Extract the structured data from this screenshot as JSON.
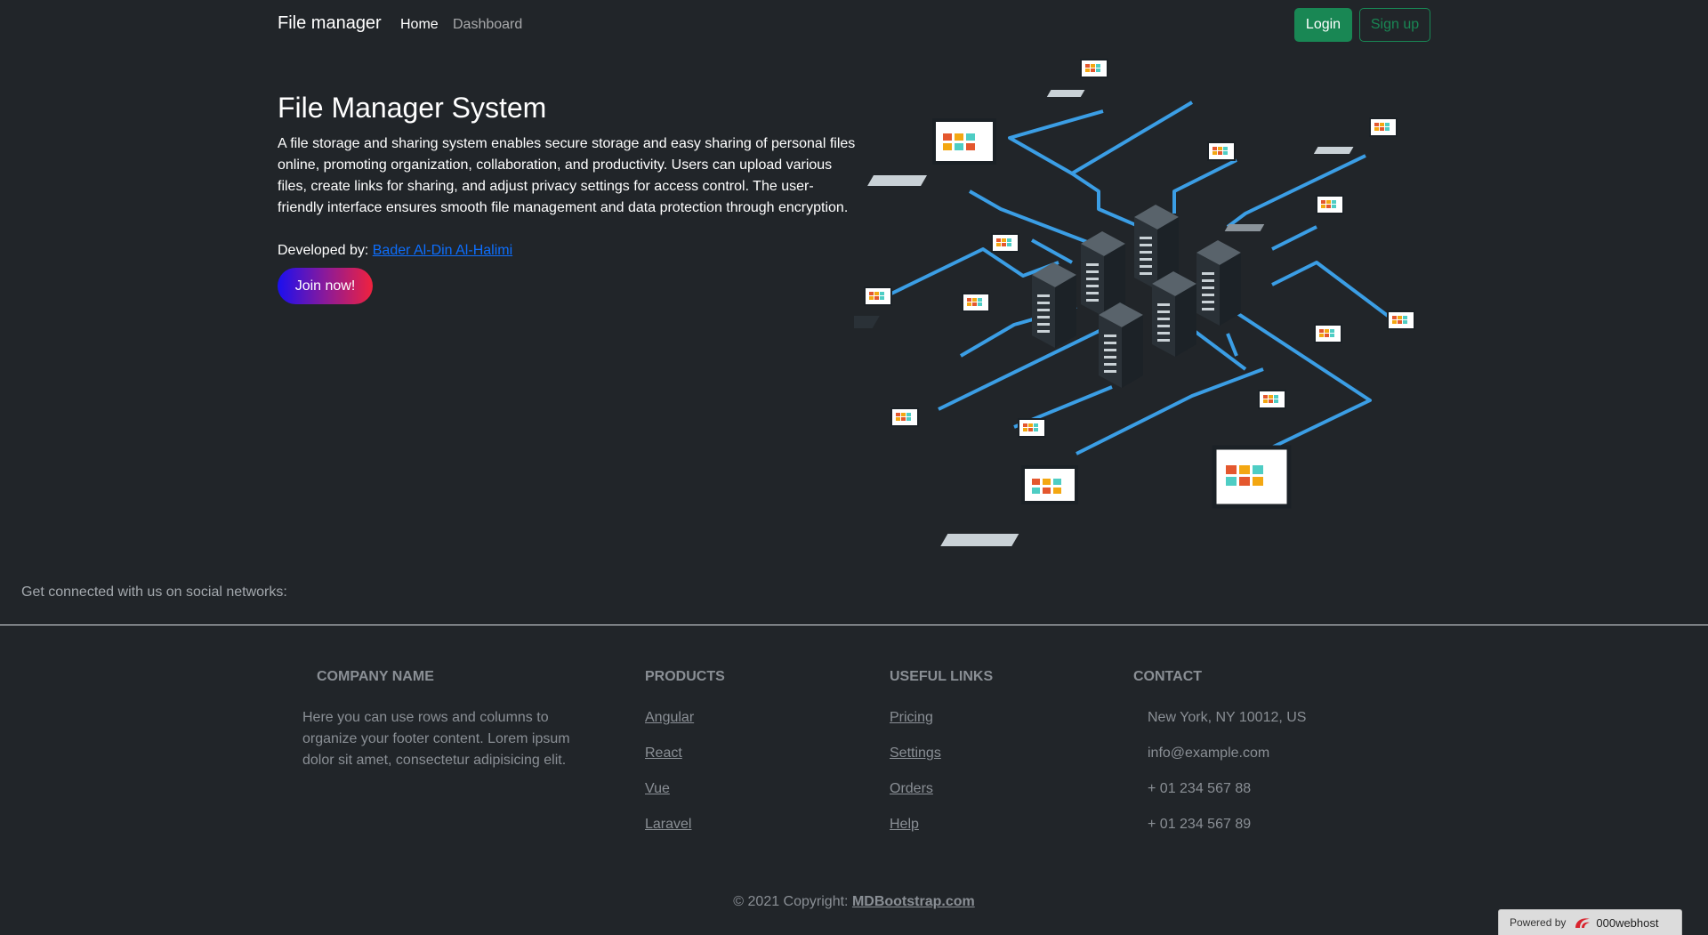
{
  "navbar": {
    "brand": "File manager",
    "links": [
      "Home",
      "Dashboard"
    ],
    "login_label": "Login",
    "signup_label": "Sign up"
  },
  "hero": {
    "title": "File Manager System",
    "description": "A file storage and sharing system enables secure storage and easy sharing of personal files online, promoting organization, collaboration, and productivity. Users can upload various files, create links for sharing, and adjust privacy settings for access control. The user-friendly interface ensures smooth file management and data protection through encryption.",
    "developed_by_label": "Developed by:",
    "developer_name": "Bader Al-Din Al-Halimi",
    "cta_label": "Join now!"
  },
  "social": {
    "text": "Get connected with us on social networks:"
  },
  "footer": {
    "company": {
      "heading": "COMPANY NAME",
      "text": "Here you can use rows and columns to organize your footer content. Lorem ipsum dolor sit amet, consectetur adipisicing elit."
    },
    "products": {
      "heading": "PRODUCTS",
      "items": [
        "Angular",
        "React",
        "Vue",
        "Laravel"
      ]
    },
    "useful_links": {
      "heading": "USEFUL LINKS",
      "items": [
        "Pricing",
        "Settings",
        "Orders",
        "Help"
      ]
    },
    "contact": {
      "heading": "CONTACT",
      "items": [
        "New York, NY 10012, US",
        "info@example.com",
        "+ 01 234 567 88",
        "+ 01 234 567 89"
      ]
    },
    "copyright_prefix": "© 2021 Copyright:",
    "copyright_link": "MDBootstrap.com"
  },
  "badge": {
    "prefix": "Powered by",
    "host": "000webhost"
  },
  "colors": {
    "background": "#212529",
    "accent_green": "#198754",
    "link_blue": "#0d6efd",
    "network_line": "#3b9ee5"
  }
}
